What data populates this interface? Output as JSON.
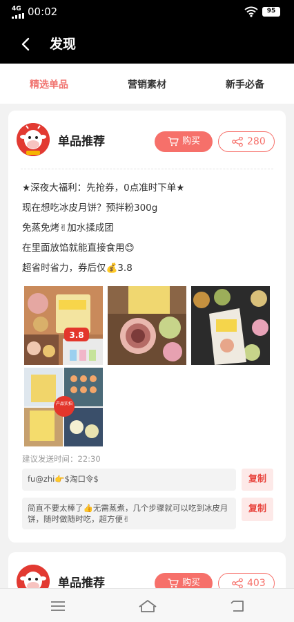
{
  "status": {
    "network": "4G",
    "time": "00:02",
    "battery": "95"
  },
  "header": {
    "title": "发现"
  },
  "tabs": [
    {
      "label": "精选单品",
      "active": true
    },
    {
      "label": "营销素材",
      "active": false
    },
    {
      "label": "新手必备",
      "active": false
    }
  ],
  "posts": [
    {
      "title": "单品推荐",
      "buy_label": "购买",
      "share_count": "280",
      "lines": [
        "★深夜大福利：先抢券，0点准时下单★",
        "现在想吃冰皮月饼？预拌粉300g",
        "免蒸免烤✌加水揉成团",
        "在里面放馅就能直接食用😊",
        "超省时省力，券后仅💰3.8"
      ],
      "images": [
        "mooncake-mix-collage",
        "mooncake-pastry-closeup",
        "mooncake-mix-package",
        "product-collage"
      ],
      "image_labels": {
        "price_tag": "3.8",
        "badge": "产品实拍"
      },
      "suggest_time": "建议发送时间：22:30",
      "copy_rows": [
        {
          "text": "fu@zhi👉$淘口令$",
          "button": "复制"
        },
        {
          "text": "简直不要太棒了👍无需蒸煮，几个步骤就可以吃到冰皮月饼，随时做随时吃，超方便✌",
          "button": "复制"
        }
      ]
    },
    {
      "title": "单品推荐",
      "buy_label": "购买",
      "share_count": "403"
    }
  ],
  "colors": {
    "accent": "#f6706a",
    "header_bg": "#000000",
    "copy_text": "#e8433c"
  },
  "icons": {
    "back": "back-arrow-icon",
    "cart": "cart-icon",
    "share": "share-icon",
    "menu": "menu-icon",
    "home": "home-icon",
    "return": "return-icon"
  }
}
